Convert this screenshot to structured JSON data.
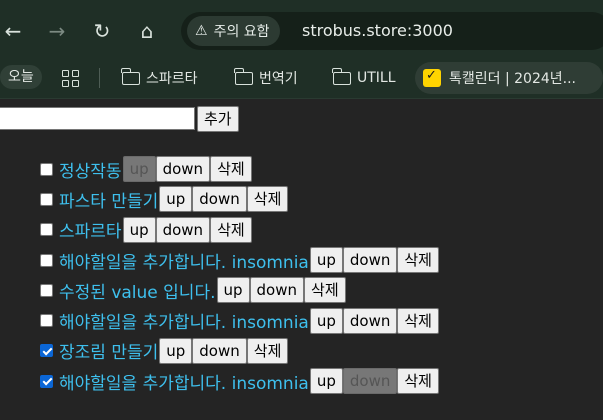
{
  "browser": {
    "security_label": "주의 요함",
    "url": "strobus.store:3000"
  },
  "bookmarks": {
    "today_label": "오늘",
    "items": [
      {
        "label": "스파르타",
        "icon": "folder-icon"
      },
      {
        "label": "번역기",
        "icon": "folder-icon"
      },
      {
        "label": "UTILL",
        "icon": "folder-icon"
      }
    ],
    "special": {
      "label": "톡캘린더 | 2024년...",
      "icon": "calendar-check-icon"
    }
  },
  "form": {
    "input_value": "",
    "add_label": "추가"
  },
  "todos": [
    {
      "text": "정상작동",
      "checked": false,
      "up_disabled": true,
      "down_disabled": false
    },
    {
      "text": "파스타 만들기",
      "checked": false,
      "up_disabled": false,
      "down_disabled": false
    },
    {
      "text": "스파르타",
      "checked": false,
      "up_disabled": false,
      "down_disabled": false
    },
    {
      "text": "해야할일을 추가합니다. insomnia",
      "checked": false,
      "up_disabled": false,
      "down_disabled": false
    },
    {
      "text": "수정된 value 입니다.",
      "checked": false,
      "up_disabled": false,
      "down_disabled": false
    },
    {
      "text": "해야할일을 추가합니다. insomnia",
      "checked": false,
      "up_disabled": false,
      "down_disabled": false
    },
    {
      "text": "장조림 만들기",
      "checked": true,
      "up_disabled": false,
      "down_disabled": false
    },
    {
      "text": "해야할일을 추가합니다. insomnia",
      "checked": true,
      "up_disabled": false,
      "down_disabled": true
    }
  ],
  "buttons": {
    "up": "up",
    "down": "down",
    "delete": "삭제"
  }
}
